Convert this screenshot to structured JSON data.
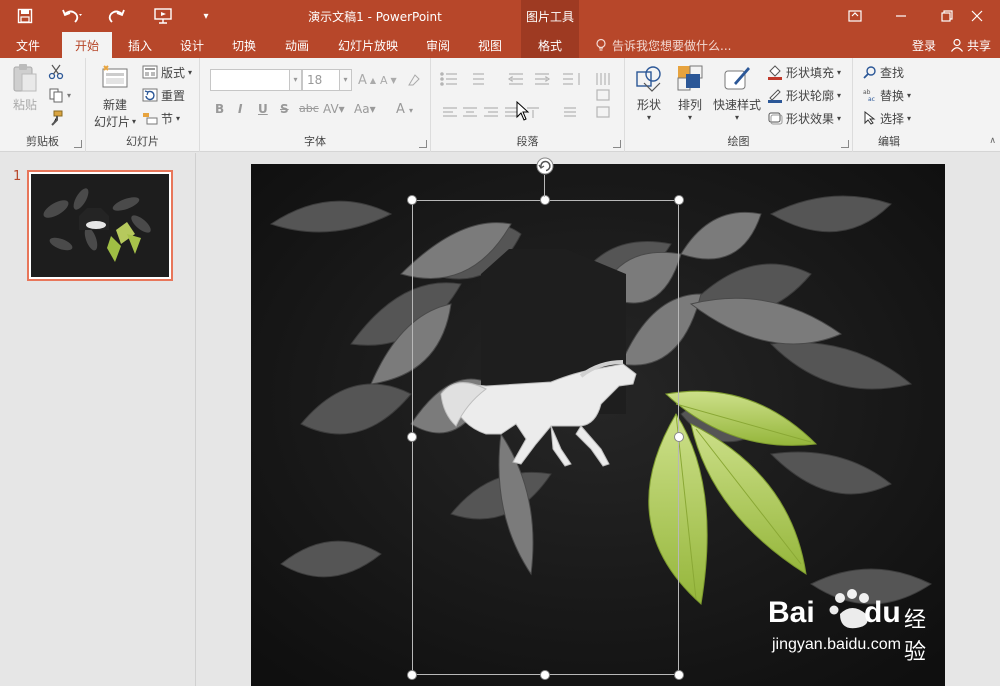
{
  "titlebar": {
    "title": "演示文稿1 - PowerPoint",
    "context_tool": "图片工具"
  },
  "tabs": [
    {
      "label": "文件"
    },
    {
      "label": "开始"
    },
    {
      "label": "插入"
    },
    {
      "label": "设计"
    },
    {
      "label": "切换"
    },
    {
      "label": "动画"
    },
    {
      "label": "幻灯片放映"
    },
    {
      "label": "审阅"
    },
    {
      "label": "视图"
    },
    {
      "label": "格式"
    }
  ],
  "tellme": "告诉我您想要做什么...",
  "account": {
    "login": "登录",
    "share": "共享"
  },
  "ribbon": {
    "clipboard": {
      "label": "剪贴板",
      "paste": "粘贴"
    },
    "slides": {
      "label": "幻灯片",
      "new_slide_1": "新建",
      "new_slide_2": "幻灯片",
      "layout": "版式",
      "reset": "重置",
      "section": "节"
    },
    "font": {
      "label": "字体",
      "font_name": "",
      "font_size": "18"
    },
    "paragraph": {
      "label": "段落"
    },
    "drawing": {
      "label": "绘图",
      "shapes": "形状",
      "arrange": "排列",
      "quick_styles": "快速样式",
      "shape_fill": "形状填充",
      "shape_outline": "形状轮廓",
      "shape_effects": "形状效果"
    },
    "editing": {
      "label": "编辑",
      "find": "查找",
      "replace": "替换",
      "select": "选择"
    }
  },
  "slides_pane": {
    "slide_number": "1"
  },
  "watermark": {
    "brand": "Bai",
    "brand2": "du",
    "product": "经验",
    "url": "jingyan.baidu.com"
  },
  "colors": {
    "accent": "#b7472a",
    "ribbon_bg": "#f3f3f3",
    "thumb_border": "#e8765a"
  }
}
